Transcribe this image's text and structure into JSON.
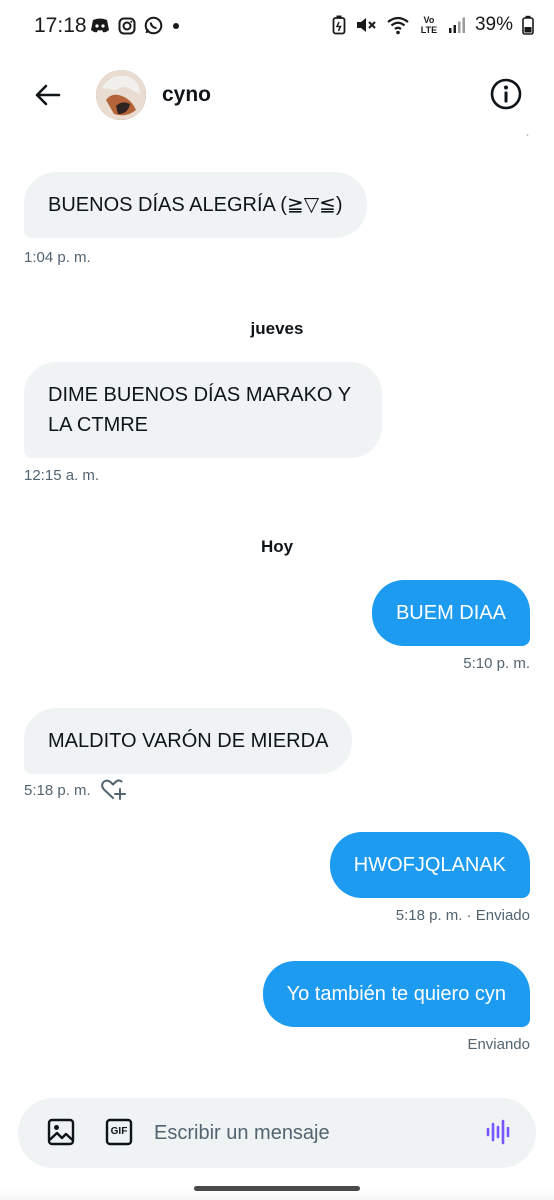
{
  "status": {
    "time": "17:18",
    "battery": "39%",
    "network_label": "Vo LTE"
  },
  "header": {
    "name": "cyno"
  },
  "messages": [
    {
      "type": "in",
      "text": "BUENOS DÍAS ALEGRÍA (≧▽≦)",
      "meta": "1:04 p. m."
    },
    {
      "type": "day",
      "text": "jueves"
    },
    {
      "type": "in",
      "text": "DIME BUENOS DÍAS MARAKO Y LA CTMRE",
      "meta": "12:15 a. m."
    },
    {
      "type": "day",
      "text": "Hoy"
    },
    {
      "type": "out",
      "text": "BUEM DIAA",
      "meta": "5:10 p. m."
    },
    {
      "type": "in",
      "text": "MALDITO VARÓN DE MIERDA",
      "meta": "5:18 p. m."
    },
    {
      "type": "out",
      "text": "HWOFJQLANAK",
      "meta": "5:18 p. m. · Enviado"
    },
    {
      "type": "out",
      "text": "Yo también te quiero cyn",
      "meta": "Enviando"
    }
  ],
  "composer": {
    "placeholder": "Escribir un mensaje",
    "gif_label": "GIF"
  },
  "colors": {
    "accent": "#1d9bf0",
    "incoming_bubble": "#eff3f4",
    "voice_icon": "#7856ff"
  },
  "icons": [
    "back-arrow-icon",
    "info-icon",
    "image-icon",
    "gif-icon",
    "voice-icon",
    "heart-add-icon"
  ]
}
